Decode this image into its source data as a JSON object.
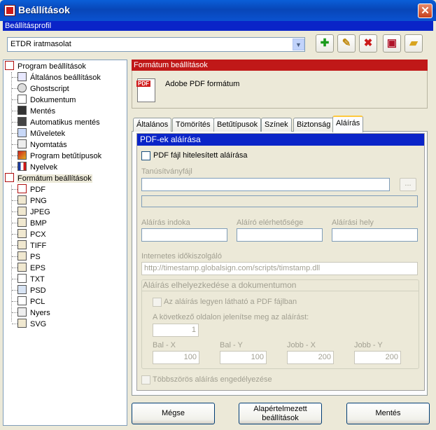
{
  "window": {
    "title": "Beállítások"
  },
  "profile": {
    "header": "Beállításprofil",
    "selected": "ETDR iratmasolat",
    "toolbar_icons": [
      "add-icon",
      "edit-icon",
      "delete-icon",
      "save-icon",
      "open-folder-icon"
    ]
  },
  "tree": {
    "program_settings": "Program beállítások",
    "program_children": [
      "Általános beállítások",
      "Ghostscript",
      "Dokumentum",
      "Mentés",
      "Automatikus mentés",
      "Műveletek",
      "Nyomtatás",
      "Program betűtípusok",
      "Nyelvek"
    ],
    "format_settings": "Formátum beállítások",
    "format_children": [
      "PDF",
      "PNG",
      "JPEG",
      "BMP",
      "PCX",
      "TIFF",
      "PS",
      "EPS",
      "TXT",
      "PSD",
      "PCL",
      "Nyers",
      "SVG"
    ]
  },
  "format_panel": {
    "header": "Formátum beállítások",
    "format_name": "Adobe PDF formátum"
  },
  "tabs": [
    "Általános",
    "Tömörítés",
    "Betűtípusok",
    "Színek",
    "Biztonság",
    "Aláírás"
  ],
  "active_tab": "Aláírás",
  "signature": {
    "title": "PDF-ek aláírása",
    "sign_checkbox": "PDF fájl hitelesített aláírása",
    "cert_label": "Tanúsítványfájl",
    "cert_value": "",
    "browse": "...",
    "reason_label": "Aláírás indoka",
    "contact_label": "Aláíró elérhetősége",
    "location_label": "Aláírási hely",
    "timestamp_label": "Internetes időkiszolgáló",
    "timestamp_value": "http://timestamp.globalsign.com/scripts/timstamp.dll",
    "placement_title": "Aláírás elhelyezkedése a dokumentumon",
    "visible_checkbox": "Az aláírás legyen látható a PDF fájlban",
    "page_label": "A következő oldalon jelenítse meg az aláírást:",
    "page_value": "1",
    "left_x_label": "Bal - X",
    "left_y_label": "Bal - Y",
    "right_x_label": "Jobb - X",
    "right_y_label": "Jobb - Y",
    "left_x": "100",
    "left_y": "100",
    "right_x": "200",
    "right_y": "200",
    "multi_checkbox": "Többszörös aláírás engedélyezése"
  },
  "buttons": {
    "cancel": "Mégse",
    "defaults": "Alapértelmezett beállítások",
    "save": "Mentés"
  }
}
